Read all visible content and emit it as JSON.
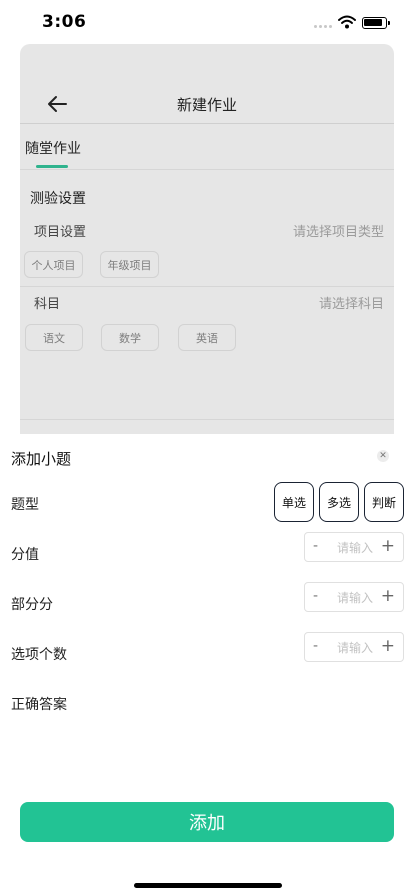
{
  "status_bar": {
    "time": "3:06"
  },
  "background_page": {
    "title": "新建作业",
    "tab": "随堂作业",
    "section_title": "测验设置",
    "project": {
      "label": "项目设置",
      "placeholder": "请选择项目类型",
      "options": [
        "个人项目",
        "年级项目"
      ]
    },
    "subject": {
      "label": "科目",
      "placeholder": "请选择科目",
      "options": [
        "语文",
        "数学",
        "英语"
      ]
    }
  },
  "sheet": {
    "title": "添加小题",
    "close_icon": "close-icon",
    "question_type": {
      "label": "题型",
      "options": [
        "单选",
        "多选",
        "判断"
      ]
    },
    "score": {
      "label": "分值",
      "minus": "-",
      "placeholder": "请输入",
      "plus": "+"
    },
    "partial_score": {
      "label": "部分分",
      "minus": "-",
      "placeholder": "请输入",
      "plus": "+"
    },
    "option_count": {
      "label": "选项个数",
      "minus": "-",
      "placeholder": "请输入",
      "plus": "+"
    },
    "correct_answer": {
      "label": "正确答案"
    },
    "add_button": "添加"
  },
  "colors": {
    "accent": "#22c394",
    "tab_indicator": "#2fb38d",
    "overlay": "#e6e6e6"
  }
}
